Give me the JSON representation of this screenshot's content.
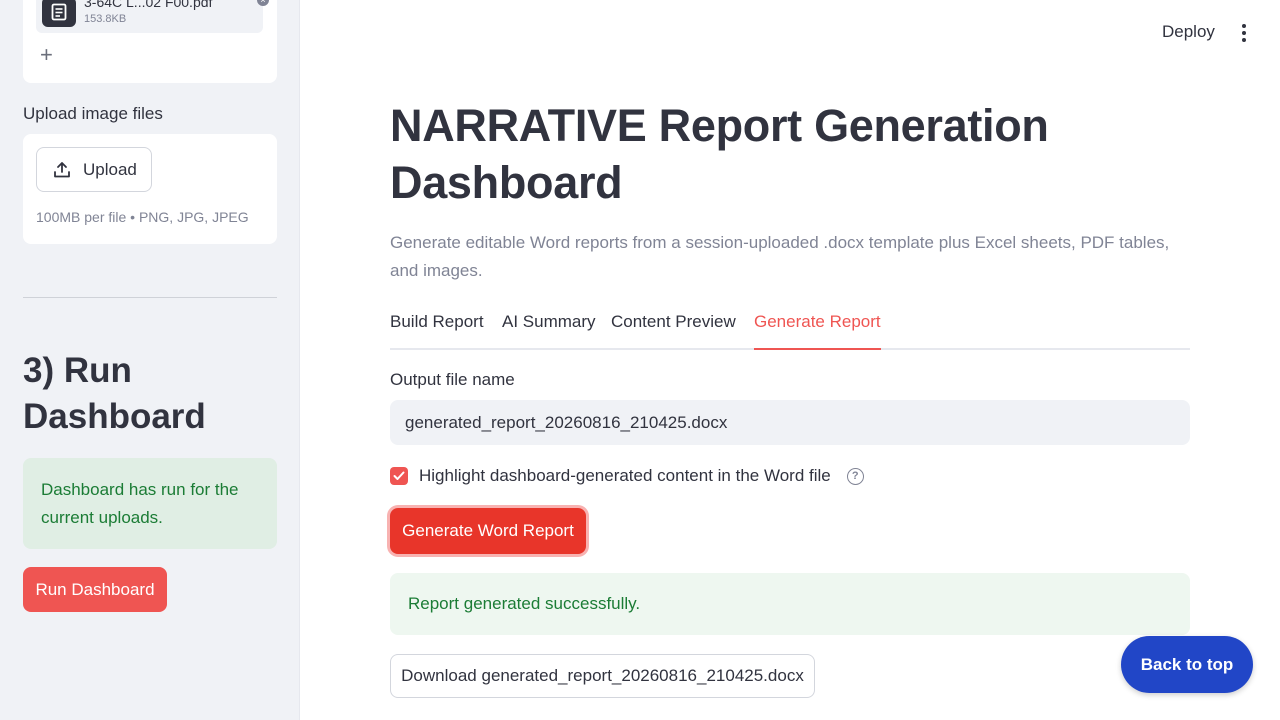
{
  "sidebar": {
    "uploaded_file": {
      "name": "3-64C L...02 F00.pdf",
      "size": "153.8KB",
      "remove_symbol": "×",
      "add_symbol": "+"
    },
    "image_upload": {
      "label": "Upload image files",
      "button_label": "Upload",
      "hint": "100MB per file • PNG, JPG, JPEG"
    },
    "run_section": {
      "title": "3) Run Dashboard",
      "status_message": "Dashboard has run for the current uploads.",
      "run_button_label": "Run Dashboard"
    }
  },
  "header": {
    "deploy_label": "Deploy",
    "menu_icon": "kebab-menu-icon"
  },
  "main": {
    "title": "NARRATIVE Report Generation Dashboard",
    "subtitle": "Generate editable Word reports from a session-uploaded .docx template plus Excel sheets, PDF tables, and images.",
    "tabs": [
      {
        "label": "Build Report",
        "active": false
      },
      {
        "label": "AI Summary",
        "active": false
      },
      {
        "label": "Content Preview",
        "active": false
      },
      {
        "label": "Generate Report",
        "active": true
      }
    ],
    "output_field": {
      "label": "Output file name",
      "value": "generated_report_20260816_210425.docx"
    },
    "highlight_checkbox": {
      "label": "Highlight dashboard-generated content in the Word file",
      "checked": true,
      "help_symbol": "?"
    },
    "generate_button_label": "Generate Word Report",
    "success_message": "Report generated successfully.",
    "download_button_label": "Download generated_report_20260816_210425.docx"
  },
  "back_to_top_label": "Back to top",
  "colors": {
    "accent": "#ef5552",
    "primary_button": "#e8352a",
    "success_text": "#1b7c35",
    "back_to_top": "#2146c7"
  }
}
